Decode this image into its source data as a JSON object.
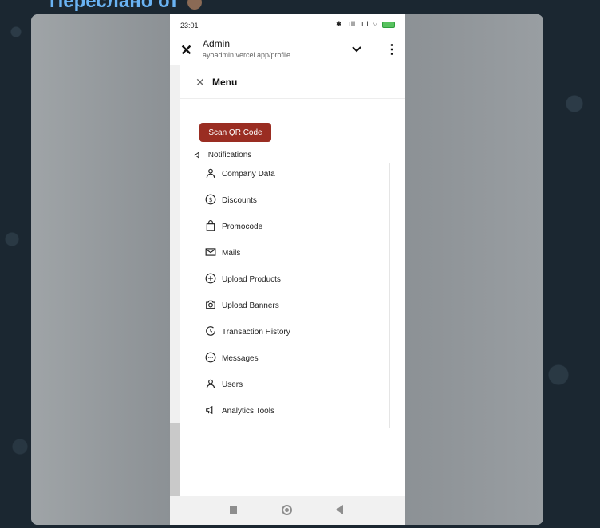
{
  "chat": {
    "forwarded_from": "Переслано от"
  },
  "status_bar": {
    "time": "23:01",
    "icons": "✱ .ıll .ıll ⌔",
    "battery_color": "#58c25f"
  },
  "browser": {
    "title": "Admin",
    "url": "ayoadmin.vercel.app/profile",
    "close_icon": "close-icon",
    "more_icon": "more-vertical-icon"
  },
  "drawer": {
    "title": "Menu",
    "scan_button": "Scan QR Code",
    "scan_button_color": "#9a2d22",
    "notifications_label": "Notifications",
    "items": [
      {
        "label": "Company Data",
        "icon": "user-icon"
      },
      {
        "label": "Discounts",
        "icon": "dollar-circle-icon"
      },
      {
        "label": "Promocode",
        "icon": "shopping-bag-icon"
      },
      {
        "label": "Mails",
        "icon": "mail-icon"
      },
      {
        "label": "Upload Products",
        "icon": "plus-circle-icon"
      },
      {
        "label": "Upload Banners",
        "icon": "camera-icon"
      },
      {
        "label": "Transaction History",
        "icon": "clock-icon"
      },
      {
        "label": "Messages",
        "icon": "message-circle-icon"
      },
      {
        "label": "Users",
        "icon": "user-icon"
      },
      {
        "label": "Analytics Tools",
        "icon": "megaphone-icon"
      }
    ]
  }
}
